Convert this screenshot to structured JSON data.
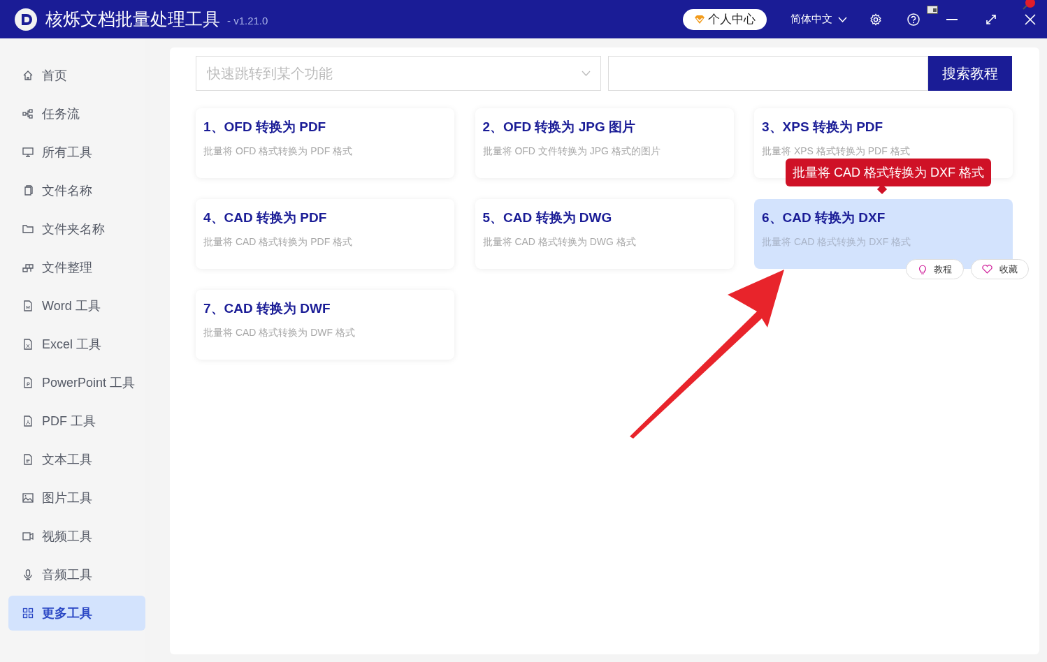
{
  "window": {
    "title": "核烁文档批量处理工具",
    "version": "- v1.21.0",
    "user_center": "个人中心",
    "language": "简体中文"
  },
  "sidebar": {
    "items": [
      {
        "label": "首页",
        "selected": false
      },
      {
        "label": "任务流",
        "selected": false
      },
      {
        "label": "所有工具",
        "selected": false
      },
      {
        "label": "文件名称",
        "selected": false
      },
      {
        "label": "文件夹名称",
        "selected": false
      },
      {
        "label": "文件整理",
        "selected": false
      },
      {
        "label": "Word 工具",
        "selected": false
      },
      {
        "label": "Excel 工具",
        "selected": false
      },
      {
        "label": "PowerPoint 工具",
        "selected": false
      },
      {
        "label": "PDF 工具",
        "selected": false
      },
      {
        "label": "文本工具",
        "selected": false
      },
      {
        "label": "图片工具",
        "selected": false
      },
      {
        "label": "视频工具",
        "selected": false
      },
      {
        "label": "音频工具",
        "selected": false
      },
      {
        "label": "更多工具",
        "selected": true
      }
    ]
  },
  "search": {
    "placeholder": "快速跳转到某个功能",
    "button": "搜索教程"
  },
  "cards": [
    {
      "title": "1、OFD 转换为 PDF",
      "description": "批量将 OFD 格式转换为 PDF 格式",
      "selected": false
    },
    {
      "title": "2、OFD 转换为 JPG 图片",
      "description": "批量将 OFD 文件转换为 JPG 格式的图片",
      "selected": false
    },
    {
      "title": "3、XPS 转换为 PDF",
      "description": "批量将 XPS 格式转换为 PDF 格式",
      "selected": false
    },
    {
      "title": "4、CAD 转换为 PDF",
      "description": "批量将 CAD 格式转换为 PDF 格式",
      "selected": false
    },
    {
      "title": "5、CAD 转换为 DWG",
      "description": "批量将 CAD 格式转换为 DWG 格式",
      "selected": false
    },
    {
      "title": "6、CAD 转换为 DXF",
      "description": "批量将 CAD 格式转换为 DXF 格式",
      "selected": true,
      "tooltip": "批量将 CAD 格式转换为 DXF 格式",
      "actions": [
        "教程",
        "收藏"
      ]
    },
    {
      "title": "7、CAD 转换为 DWF",
      "description": "批量将 CAD 格式转换为 DWF 格式",
      "selected": false
    }
  ]
}
